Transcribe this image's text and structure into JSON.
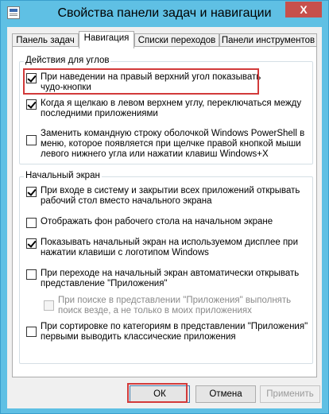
{
  "window": {
    "title": "Свойства панели задач и навигации",
    "close_glyph": "X"
  },
  "tabs": [
    {
      "label": "Панель задач"
    },
    {
      "label": "Навигация"
    },
    {
      "label": "Списки переходов"
    },
    {
      "label": "Панели инструментов"
    }
  ],
  "corners": {
    "label": "Действия для углов",
    "options": [
      {
        "text": "При наведении на правый верхний угол показывать\nчудо-кнопки",
        "checked": true
      },
      {
        "text": "Когда я щелкаю в левом верхнем углу, переключаться между\nпоследними приложениями",
        "checked": true
      },
      {
        "text": "Заменить командную строку оболочкой Windows PowerShell в\nменю, которое появляется при щелчке правой кнопкой мыши\nлевого нижнего угла или нажатии клавиш Windows+X",
        "checked": false
      }
    ]
  },
  "start": {
    "label": "Начальный экран",
    "options": [
      {
        "text": "При входе в систему и закрытии всех приложений открывать\nрабочий стол вместо начального экрана",
        "checked": true
      },
      {
        "text": "Отображать фон рабочего стола на начальном экране",
        "checked": false
      },
      {
        "text": "Показывать начальный экран на используемом дисплее при\nнажатии клавиши с логотипом Windows",
        "checked": true
      },
      {
        "text": "При переходе на начальный экран автоматически открывать\nпредставление \"Приложения\"",
        "checked": false
      },
      {
        "text": "При поиске в представлении \"Приложения\" выполнять\nпоиск везде, а не только в моих приложениях",
        "checked": false
      },
      {
        "text": "При сортировке по категориям в представлении \"Приложения\"\nпервыми выводить классические приложения",
        "checked": false
      }
    ]
  },
  "buttons": {
    "ok": "ОК",
    "cancel": "Отмена",
    "apply": "Применить"
  },
  "colors": {
    "frame": "#5fc0e4",
    "close": "#c7504c",
    "highlight": "#d23a3a"
  }
}
